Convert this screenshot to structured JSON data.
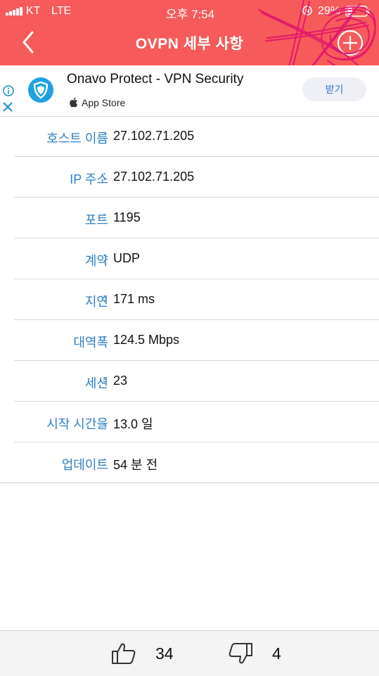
{
  "status_bar": {
    "carrier": "KT",
    "network": "LTE",
    "time": "오후 7:54",
    "battery": "29%"
  },
  "nav": {
    "title": "OVPN 세부 사항",
    "back_icon": "chevron-left-icon",
    "add_icon": "plus-circle-icon"
  },
  "ad": {
    "title": "Onavo Protect - VPN Security",
    "store": "App Store",
    "get_label": "받기",
    "accent_color": "#1da1e2"
  },
  "details": [
    {
      "label": "호스트 이름",
      "value": "27.102.71.205"
    },
    {
      "label": "IP 주소",
      "value": "27.102.71.205"
    },
    {
      "label": "포트",
      "value": "1195"
    },
    {
      "label": "계약",
      "value": "UDP"
    },
    {
      "label": "지연",
      "value": "171 ms"
    },
    {
      "label": "대역폭",
      "value": "124.5 Mbps"
    },
    {
      "label": "세션",
      "value": "23"
    },
    {
      "label": "시작 시간을",
      "value": "13.0 일"
    },
    {
      "label": "업데이트",
      "value": "54 분 전"
    }
  ],
  "votes": {
    "up": "34",
    "down": "4"
  },
  "colors": {
    "header": "#f65a5a",
    "label": "#2f7fc6",
    "scribble": "#e0136e"
  }
}
